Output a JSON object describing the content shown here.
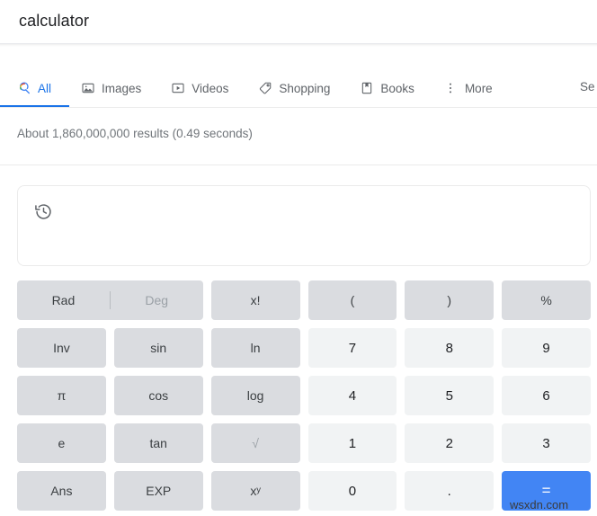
{
  "search": {
    "query": "calculator"
  },
  "tabs": [
    {
      "label": "All",
      "icon": "google-search-icon",
      "active": true
    },
    {
      "label": "Images",
      "icon": "image-icon",
      "active": false
    },
    {
      "label": "Videos",
      "icon": "video-icon",
      "active": false
    },
    {
      "label": "Shopping",
      "icon": "tag-icon",
      "active": false
    },
    {
      "label": "Books",
      "icon": "book-icon",
      "active": false
    },
    {
      "label": "More",
      "icon": "kebab-menu-icon",
      "active": false
    }
  ],
  "tab_overflow_label": "Se",
  "result_stats": "About 1,860,000,000 results (0.49 seconds)",
  "calculator": {
    "history_icon": "history-icon",
    "display_value": "",
    "angle_mode": {
      "rad_label": "Rad",
      "deg_label": "Deg",
      "selected": "Rad"
    },
    "keys": [
      {
        "label": "x!",
        "name": "factorial",
        "style": "fn"
      },
      {
        "label": "(",
        "name": "open-paren",
        "style": "fn"
      },
      {
        "label": ")",
        "name": "close-paren",
        "style": "fn"
      },
      {
        "label": "%",
        "name": "percent",
        "style": "fn"
      },
      {
        "label": "Inv",
        "name": "inverse",
        "style": "fn"
      },
      {
        "label": "sin",
        "name": "sin",
        "style": "fn"
      },
      {
        "label": "ln",
        "name": "ln",
        "style": "fn"
      },
      {
        "label": "7",
        "name": "seven",
        "style": "num"
      },
      {
        "label": "8",
        "name": "eight",
        "style": "num"
      },
      {
        "label": "9",
        "name": "nine",
        "style": "num"
      },
      {
        "label": "π",
        "name": "pi",
        "style": "fn"
      },
      {
        "label": "cos",
        "name": "cos",
        "style": "fn"
      },
      {
        "label": "log",
        "name": "log",
        "style": "fn"
      },
      {
        "label": "4",
        "name": "four",
        "style": "num"
      },
      {
        "label": "5",
        "name": "five",
        "style": "num"
      },
      {
        "label": "6",
        "name": "six",
        "style": "num"
      },
      {
        "label": "e",
        "name": "euler",
        "style": "fn"
      },
      {
        "label": "tan",
        "name": "tan",
        "style": "fn"
      },
      {
        "label": "√",
        "name": "square-root",
        "style": "fn-dim"
      },
      {
        "label": "1",
        "name": "one",
        "style": "num"
      },
      {
        "label": "2",
        "name": "two",
        "style": "num"
      },
      {
        "label": "3",
        "name": "three",
        "style": "num"
      },
      {
        "label": "Ans",
        "name": "answer",
        "style": "fn"
      },
      {
        "label": "EXP",
        "name": "exponent",
        "style": "fn"
      },
      {
        "label": "xʸ",
        "name": "power",
        "style": "fn"
      },
      {
        "label": "0",
        "name": "zero",
        "style": "num"
      },
      {
        "label": ".",
        "name": "decimal-point",
        "style": "num"
      },
      {
        "label": "=",
        "name": "equals",
        "style": "equals"
      }
    ]
  },
  "watermark": "wsxdn.com",
  "colors": {
    "accent_blue": "#1a73e8",
    "equals_blue": "#4285f4",
    "key_fn": "#dadce0",
    "key_num": "#f1f3f4",
    "text_primary": "#202124",
    "text_secondary": "#5f6368",
    "text_muted": "#70757a"
  }
}
